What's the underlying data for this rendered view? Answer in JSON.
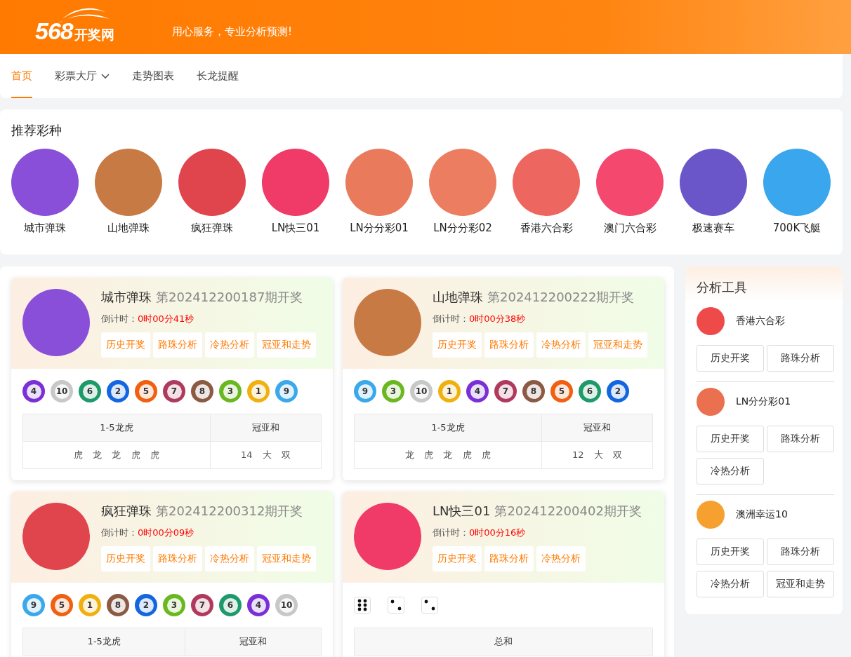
{
  "header": {
    "logo_number": "568",
    "logo_text": "开奖网",
    "tagline": "用心服务，专业分析预测!"
  },
  "nav": [
    {
      "label": "首页",
      "selected": true,
      "has_dropdown": false
    },
    {
      "label": "彩票大厅",
      "selected": false,
      "has_dropdown": true
    },
    {
      "label": "走势图表",
      "selected": false,
      "has_dropdown": false
    },
    {
      "label": "长龙提醒",
      "selected": false,
      "has_dropdown": false
    }
  ],
  "recommended": {
    "title": "推荐彩种",
    "items": [
      {
        "name": "城市弹珠",
        "color": "#8a4fd8"
      },
      {
        "name": "山地弹珠",
        "color": "#c87a44"
      },
      {
        "name": "疯狂弹珠",
        "color": "#e0444c"
      },
      {
        "name": "LN快三01",
        "color": "#f03a68"
      },
      {
        "name": "LN分分彩01",
        "color": "#ea7a5c"
      },
      {
        "name": "LN分分彩02",
        "color": "#ec7d60"
      },
      {
        "name": "香港六合彩",
        "color": "#ee6660"
      },
      {
        "name": "澳门六合彩",
        "color": "#f4486e"
      },
      {
        "name": "极速赛车",
        "color": "#6a56c8"
      },
      {
        "name": "700K飞艇",
        "color": "#3aa6ee"
      }
    ]
  },
  "games": [
    {
      "name": "城市弹珠",
      "period": "第202412200187期开奖",
      "countdown_label": "倒计时：",
      "countdown": "0时00分41秒",
      "color": "#8a4fd8",
      "actions": [
        "历史开奖",
        "路珠分析",
        "冷热分析",
        "冠亚和走势"
      ],
      "kind": "balls",
      "balls": [
        {
          "number": "4",
          "color": "#7b2fd6"
        },
        {
          "number": "10",
          "color": "#c8c8c8"
        },
        {
          "number": "6",
          "color": "#1e9a6a"
        },
        {
          "number": "2",
          "color": "#1466e0"
        },
        {
          "number": "5",
          "color": "#f06010"
        },
        {
          "number": "7",
          "color": "#b03a5e"
        },
        {
          "number": "8",
          "color": "#8a5a44"
        },
        {
          "number": "3",
          "color": "#6ab820"
        },
        {
          "number": "1",
          "color": "#f0b010"
        },
        {
          "number": "9",
          "color": "#3aa8ea"
        }
      ],
      "table": {
        "headers": [
          "1-5龙虎",
          "冠亚和"
        ],
        "rows": [
          [
            "虎 龙 龙 虎 虎",
            "14 大 双"
          ]
        ]
      }
    },
    {
      "name": "山地弹珠",
      "period": "第202412200222期开奖",
      "countdown_label": "倒计时：",
      "countdown": "0时00分38秒",
      "color": "#c87a44",
      "actions": [
        "历史开奖",
        "路珠分析",
        "冷热分析",
        "冠亚和走势"
      ],
      "kind": "balls",
      "balls": [
        {
          "number": "9",
          "color": "#3aa8ea"
        },
        {
          "number": "3",
          "color": "#6ab820"
        },
        {
          "number": "10",
          "color": "#c8c8c8"
        },
        {
          "number": "1",
          "color": "#f0b010"
        },
        {
          "number": "4",
          "color": "#7b2fd6"
        },
        {
          "number": "7",
          "color": "#b03a5e"
        },
        {
          "number": "8",
          "color": "#8a5a44"
        },
        {
          "number": "5",
          "color": "#f06010"
        },
        {
          "number": "6",
          "color": "#1e9a6a"
        },
        {
          "number": "2",
          "color": "#1466e0"
        }
      ],
      "table": {
        "headers": [
          "1-5龙虎",
          "冠亚和"
        ],
        "rows": [
          [
            "龙 虎 龙 虎 虎",
            "12 大 双"
          ]
        ]
      }
    },
    {
      "name": "疯狂弹珠",
      "period": "第202412200312期开奖",
      "countdown_label": "倒计时：",
      "countdown": "0时00分09秒",
      "color": "#e0444c",
      "actions": [
        "历史开奖",
        "路珠分析",
        "冷热分析",
        "冠亚和走势"
      ],
      "kind": "balls",
      "balls": [
        {
          "number": "9",
          "color": "#3aa8ea"
        },
        {
          "number": "5",
          "color": "#f06010"
        },
        {
          "number": "1",
          "color": "#f0b010"
        },
        {
          "number": "8",
          "color": "#8a5a44"
        },
        {
          "number": "2",
          "color": "#1466e0"
        },
        {
          "number": "3",
          "color": "#6ab820"
        },
        {
          "number": "7",
          "color": "#b03a5e"
        },
        {
          "number": "6",
          "color": "#1e9a6a"
        },
        {
          "number": "4",
          "color": "#7b2fd6"
        },
        {
          "number": "10",
          "color": "#c8c8c8"
        }
      ],
      "table": {
        "headers": [
          "1-5龙虎",
          "冠亚和"
        ]
      }
    },
    {
      "name": "LN快三01",
      "period": "第202412200402期开奖",
      "countdown_label": "倒计时：",
      "countdown": "0时00分16秒",
      "color": "#f03a68",
      "actions": [
        "历史开奖",
        "路珠分析",
        "冷热分析"
      ],
      "kind": "dice",
      "dice": [
        {
          "kind": "six"
        },
        {
          "kind": "two"
        },
        {
          "kind": "two"
        }
      ],
      "table": {
        "headers": [
          "总和"
        ]
      }
    }
  ],
  "tools": {
    "title": "分析工具",
    "items": [
      {
        "name": "香港六合彩",
        "color": "#ee4a4a",
        "buttons": [
          "历史开奖",
          "路珠分析"
        ]
      },
      {
        "name": "LN分分彩01",
        "color": "#ea7050",
        "buttons": [
          "历史开奖",
          "路珠分析",
          "冷热分析"
        ]
      },
      {
        "name": "澳洲幸运10",
        "color": "#f6a030",
        "buttons": [
          "历史开奖",
          "路珠分析",
          "冷热分析",
          "冠亚和走势"
        ]
      }
    ]
  }
}
